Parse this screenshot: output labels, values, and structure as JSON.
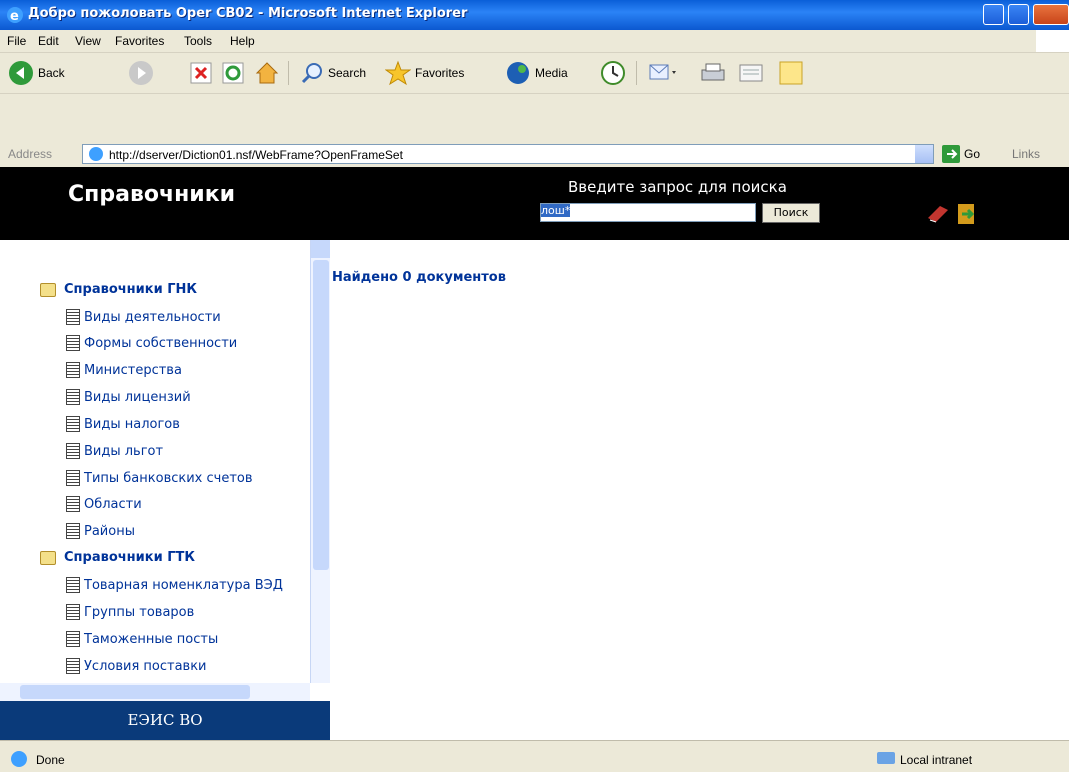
{
  "window": {
    "title": "Добро пожоловать Oper CB02 - Microsoft Internet Explorer"
  },
  "menu": [
    "File",
    "Edit",
    "View",
    "Favorites",
    "Tools",
    "Help"
  ],
  "toolbar": {
    "back": "Back",
    "search": "Search",
    "favorites": "Favorites",
    "media": "Media"
  },
  "address": {
    "label": "Address",
    "url": "http://dserver/Diction01.nsf/WebFrame?OpenFrameSet",
    "go": "Go",
    "links": "Links"
  },
  "header": {
    "brand": "Справочники",
    "search_label": "Введите запрос для поиска",
    "search_value": "лош*",
    "search_button": "Поиск"
  },
  "tree": {
    "groups": [
      {
        "label": "Справочники ГНК",
        "items": [
          "Виды деятельности",
          "Формы собственности",
          "Министерства",
          "Виды лицензий",
          "Виды налогов",
          "Виды льгот",
          "Типы банковских счетов",
          "Области",
          "Районы"
        ]
      },
      {
        "label": "Справочники ГТК",
        "items": [
          "Товарная номенклатура ВЭД",
          "Группы товаров",
          "Таможенные посты",
          "Условия поставки"
        ]
      }
    ]
  },
  "footer_left": "ЕЭИС ВО",
  "main": {
    "result": "Найдено 0 документов"
  },
  "status": {
    "text": "Done",
    "zone": "Local intranet"
  }
}
